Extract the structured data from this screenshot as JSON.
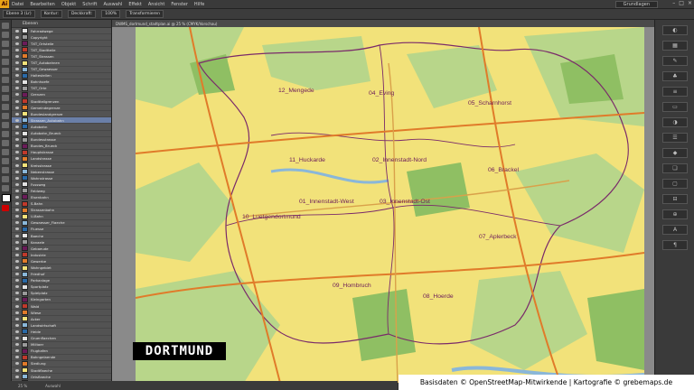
{
  "menubar": {
    "app_icon": "Ai",
    "items": [
      "Datei",
      "Bearbeiten",
      "Objekt",
      "Schrift",
      "Auswahl",
      "Effekt",
      "Ansicht",
      "Fenster",
      "Hilfe"
    ],
    "workspace": "Grundlagen"
  },
  "controlbar": {
    "items": [
      "Ebene 3 (Lr)",
      "Kontur:",
      "Deckkraft:",
      "100%",
      "Transformieren"
    ]
  },
  "document": {
    "tab_title": "DWMS_dortmund_stadtplan.ai @ 25 % (CMYK/Vorschau)"
  },
  "layers": {
    "header": "Ebenen",
    "rows": [
      {
        "name": "Fahrradwege"
      },
      {
        "name": "Copyright"
      },
      {
        "name": "TXT_Ortsteile"
      },
      {
        "name": "TXT_Stadtteile"
      },
      {
        "name": "TXT_Strassen"
      },
      {
        "name": "TXT_Autobahnen"
      },
      {
        "name": "TXT_Gewaesser"
      },
      {
        "name": "Haltestellen"
      },
      {
        "name": "Bahnhoefe"
      },
      {
        "name": "TXT_Orte"
      },
      {
        "name": "Grenzen"
      },
      {
        "name": "Stadtteilgrenzen"
      },
      {
        "name": "Gemeindegrenze"
      },
      {
        "name": "Bundeslandgrenze"
      },
      {
        "name": "Strassen_Autobahn"
      },
      {
        "name": "Autobahn"
      },
      {
        "name": "Autobahn_Brueck"
      },
      {
        "name": "Bundesstrasse"
      },
      {
        "name": "Bundes_Brueck"
      },
      {
        "name": "Hauptstrasse"
      },
      {
        "name": "Landstrasse"
      },
      {
        "name": "Kreisstrasse"
      },
      {
        "name": "Nebenstrasse"
      },
      {
        "name": "Wohnstrasse"
      },
      {
        "name": "Fussweg"
      },
      {
        "name": "Feldweg"
      },
      {
        "name": "Eisenbahn"
      },
      {
        "name": "S-Bahn"
      },
      {
        "name": "Strassenbahn"
      },
      {
        "name": "U-Bahn"
      },
      {
        "name": "Gewaesser_Flaeche"
      },
      {
        "name": "Fluesse"
      },
      {
        "name": "Baeche"
      },
      {
        "name": "Kanaele"
      },
      {
        "name": "Gebaeude"
      },
      {
        "name": "Industrie"
      },
      {
        "name": "Gewerbe"
      },
      {
        "name": "Wohngebiet"
      },
      {
        "name": "Friedhof"
      },
      {
        "name": "Parkanlage"
      },
      {
        "name": "Sportplatz"
      },
      {
        "name": "Spielplatz"
      },
      {
        "name": "Kleingarten"
      },
      {
        "name": "Wald"
      },
      {
        "name": "Wiese"
      },
      {
        "name": "Acker"
      },
      {
        "name": "Landwirtschaft"
      },
      {
        "name": "Heide"
      },
      {
        "name": "Gruenflaechen"
      },
      {
        "name": "Militaer"
      },
      {
        "name": "Flughafen"
      },
      {
        "name": "Bahngelaende"
      },
      {
        "name": "Siedlung"
      },
      {
        "name": "Stadtflaeche"
      },
      {
        "name": "Ortsflaeche"
      },
      {
        "name": "Umland"
      },
      {
        "name": "Hintergrund"
      }
    ],
    "selected_index": 14
  },
  "map": {
    "badge": "DORTMUND",
    "credit": "Basisdaten © OpenStreetMap-Mitwirkende | Kartografie © grebemaps.de",
    "colors": {
      "urban": "#f2e27a",
      "green": "#b8d68a",
      "forest": "#8fbf63",
      "boundary": "#7a2a6a",
      "highway": "#e07b2a",
      "water": "#8ab7d9"
    },
    "districts": [
      "12_Mengede",
      "04_Eving",
      "05_Scharnhorst",
      "11_Huckarde",
      "02_Innenstadt-Nord",
      "06_Brackel",
      "01_Innenstadt-West",
      "03_Innenstadt-Ost",
      "10_Luetgendortmund",
      "07_Aplerbeck",
      "09_Hombruch",
      "08_Hoerde"
    ]
  },
  "status": {
    "zoom": "25 %",
    "tool": "Auswahl"
  }
}
